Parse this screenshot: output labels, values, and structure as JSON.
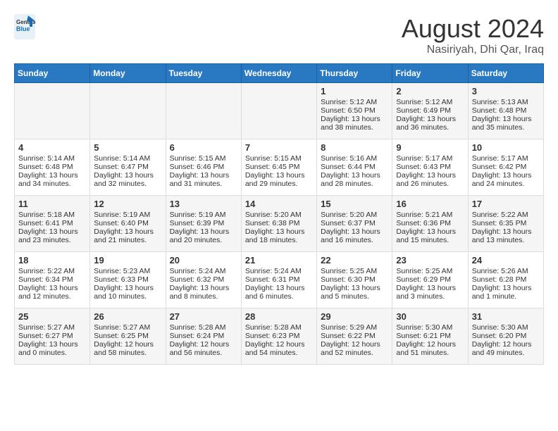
{
  "header": {
    "logo_text_general": "General",
    "logo_text_blue": "Blue",
    "month_year": "August 2024",
    "location": "Nasiriyah, Dhi Qar, Iraq"
  },
  "days_of_week": [
    "Sunday",
    "Monday",
    "Tuesday",
    "Wednesday",
    "Thursday",
    "Friday",
    "Saturday"
  ],
  "weeks": [
    [
      {
        "day": "",
        "content": ""
      },
      {
        "day": "",
        "content": ""
      },
      {
        "day": "",
        "content": ""
      },
      {
        "day": "",
        "content": ""
      },
      {
        "day": "1",
        "content": "Sunrise: 5:12 AM\nSunset: 6:50 PM\nDaylight: 13 hours\nand 38 minutes."
      },
      {
        "day": "2",
        "content": "Sunrise: 5:12 AM\nSunset: 6:49 PM\nDaylight: 13 hours\nand 36 minutes."
      },
      {
        "day": "3",
        "content": "Sunrise: 5:13 AM\nSunset: 6:48 PM\nDaylight: 13 hours\nand 35 minutes."
      }
    ],
    [
      {
        "day": "4",
        "content": "Sunrise: 5:14 AM\nSunset: 6:48 PM\nDaylight: 13 hours\nand 34 minutes."
      },
      {
        "day": "5",
        "content": "Sunrise: 5:14 AM\nSunset: 6:47 PM\nDaylight: 13 hours\nand 32 minutes."
      },
      {
        "day": "6",
        "content": "Sunrise: 5:15 AM\nSunset: 6:46 PM\nDaylight: 13 hours\nand 31 minutes."
      },
      {
        "day": "7",
        "content": "Sunrise: 5:15 AM\nSunset: 6:45 PM\nDaylight: 13 hours\nand 29 minutes."
      },
      {
        "day": "8",
        "content": "Sunrise: 5:16 AM\nSunset: 6:44 PM\nDaylight: 13 hours\nand 28 minutes."
      },
      {
        "day": "9",
        "content": "Sunrise: 5:17 AM\nSunset: 6:43 PM\nDaylight: 13 hours\nand 26 minutes."
      },
      {
        "day": "10",
        "content": "Sunrise: 5:17 AM\nSunset: 6:42 PM\nDaylight: 13 hours\nand 24 minutes."
      }
    ],
    [
      {
        "day": "11",
        "content": "Sunrise: 5:18 AM\nSunset: 6:41 PM\nDaylight: 13 hours\nand 23 minutes."
      },
      {
        "day": "12",
        "content": "Sunrise: 5:19 AM\nSunset: 6:40 PM\nDaylight: 13 hours\nand 21 minutes."
      },
      {
        "day": "13",
        "content": "Sunrise: 5:19 AM\nSunset: 6:39 PM\nDaylight: 13 hours\nand 20 minutes."
      },
      {
        "day": "14",
        "content": "Sunrise: 5:20 AM\nSunset: 6:38 PM\nDaylight: 13 hours\nand 18 minutes."
      },
      {
        "day": "15",
        "content": "Sunrise: 5:20 AM\nSunset: 6:37 PM\nDaylight: 13 hours\nand 16 minutes."
      },
      {
        "day": "16",
        "content": "Sunrise: 5:21 AM\nSunset: 6:36 PM\nDaylight: 13 hours\nand 15 minutes."
      },
      {
        "day": "17",
        "content": "Sunrise: 5:22 AM\nSunset: 6:35 PM\nDaylight: 13 hours\nand 13 minutes."
      }
    ],
    [
      {
        "day": "18",
        "content": "Sunrise: 5:22 AM\nSunset: 6:34 PM\nDaylight: 13 hours\nand 12 minutes."
      },
      {
        "day": "19",
        "content": "Sunrise: 5:23 AM\nSunset: 6:33 PM\nDaylight: 13 hours\nand 10 minutes."
      },
      {
        "day": "20",
        "content": "Sunrise: 5:24 AM\nSunset: 6:32 PM\nDaylight: 13 hours\nand 8 minutes."
      },
      {
        "day": "21",
        "content": "Sunrise: 5:24 AM\nSunset: 6:31 PM\nDaylight: 13 hours\nand 6 minutes."
      },
      {
        "day": "22",
        "content": "Sunrise: 5:25 AM\nSunset: 6:30 PM\nDaylight: 13 hours\nand 5 minutes."
      },
      {
        "day": "23",
        "content": "Sunrise: 5:25 AM\nSunset: 6:29 PM\nDaylight: 13 hours\nand 3 minutes."
      },
      {
        "day": "24",
        "content": "Sunrise: 5:26 AM\nSunset: 6:28 PM\nDaylight: 13 hours\nand 1 minute."
      }
    ],
    [
      {
        "day": "25",
        "content": "Sunrise: 5:27 AM\nSunset: 6:27 PM\nDaylight: 13 hours\nand 0 minutes."
      },
      {
        "day": "26",
        "content": "Sunrise: 5:27 AM\nSunset: 6:25 PM\nDaylight: 12 hours\nand 58 minutes."
      },
      {
        "day": "27",
        "content": "Sunrise: 5:28 AM\nSunset: 6:24 PM\nDaylight: 12 hours\nand 56 minutes."
      },
      {
        "day": "28",
        "content": "Sunrise: 5:28 AM\nSunset: 6:23 PM\nDaylight: 12 hours\nand 54 minutes."
      },
      {
        "day": "29",
        "content": "Sunrise: 5:29 AM\nSunset: 6:22 PM\nDaylight: 12 hours\nand 52 minutes."
      },
      {
        "day": "30",
        "content": "Sunrise: 5:30 AM\nSunset: 6:21 PM\nDaylight: 12 hours\nand 51 minutes."
      },
      {
        "day": "31",
        "content": "Sunrise: 5:30 AM\nSunset: 6:20 PM\nDaylight: 12 hours\nand 49 minutes."
      }
    ]
  ]
}
